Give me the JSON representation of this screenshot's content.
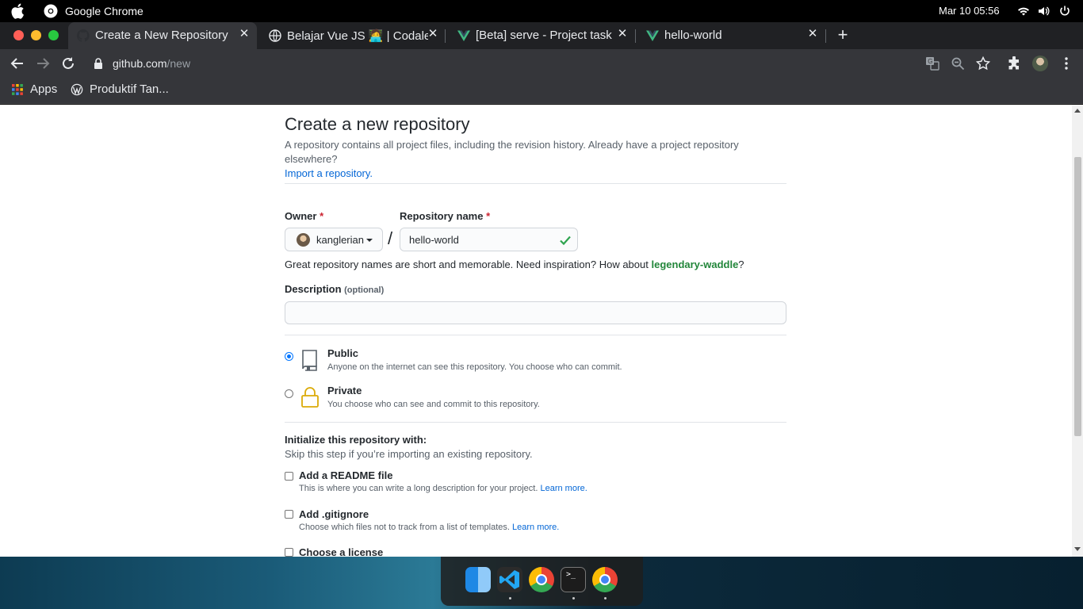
{
  "os": {
    "app_name": "Google Chrome",
    "clock": "Mar 10  05:56"
  },
  "tabs": [
    {
      "title": "Create a New Repository",
      "active": true
    },
    {
      "title": "Belajar Vue JS 🧑‍💻 | Codale",
      "active": false
    },
    {
      "title": "[Beta] serve - Project task",
      "active": false
    },
    {
      "title": "hello-world",
      "active": false
    }
  ],
  "toolbar": {
    "url_host": "github.com",
    "url_path": "/new"
  },
  "bookmarks": [
    {
      "label": "Apps",
      "icon": "apps-grid-icon"
    },
    {
      "label": "Produktif Tan...",
      "icon": "wordpress-icon"
    }
  ],
  "page": {
    "title": "Create a new repository",
    "subtitle": "A repository contains all project files, including the revision history. Already have a project repository elsewhere?",
    "import_link": "Import a repository.",
    "owner_label": "Owner",
    "required_mark": "*",
    "repo_label": "Repository name",
    "owner_value": "kanglerian",
    "slash": "/",
    "repo_value": "hello-world",
    "hint_prefix": "Great repository names are short and memorable. Need inspiration? How about",
    "hint_suggestion": "legendary-waddle",
    "hint_suffix": "?",
    "description_label": "Description",
    "description_optional": "(optional)",
    "description_value": "",
    "visibility": [
      {
        "title": "Public",
        "note": "Anyone on the internet can see this repository. You choose who can commit.",
        "selected": true
      },
      {
        "title": "Private",
        "note": "You choose who can see and commit to this repository.",
        "selected": false
      }
    ],
    "init_title": "Initialize this repository with:",
    "init_note": "Skip this step if you’re importing an existing repository.",
    "init_options": [
      {
        "title": "Add a README file",
        "note": "This is where you can write a long description for your project.",
        "link": "Learn more."
      },
      {
        "title": "Add .gitignore",
        "note": "Choose which files not to track from a list of templates.",
        "link": "Learn more."
      },
      {
        "title": "Choose a license",
        "note": "",
        "link": ""
      }
    ]
  },
  "colors": {
    "link": "#0366d6",
    "success": "#22863a",
    "required": "#cb2431",
    "radio": "#0075ff"
  },
  "dock": [
    "finder-icon",
    "vscode-icon",
    "chrome-icon",
    "terminal-icon",
    "chrome-icon"
  ]
}
